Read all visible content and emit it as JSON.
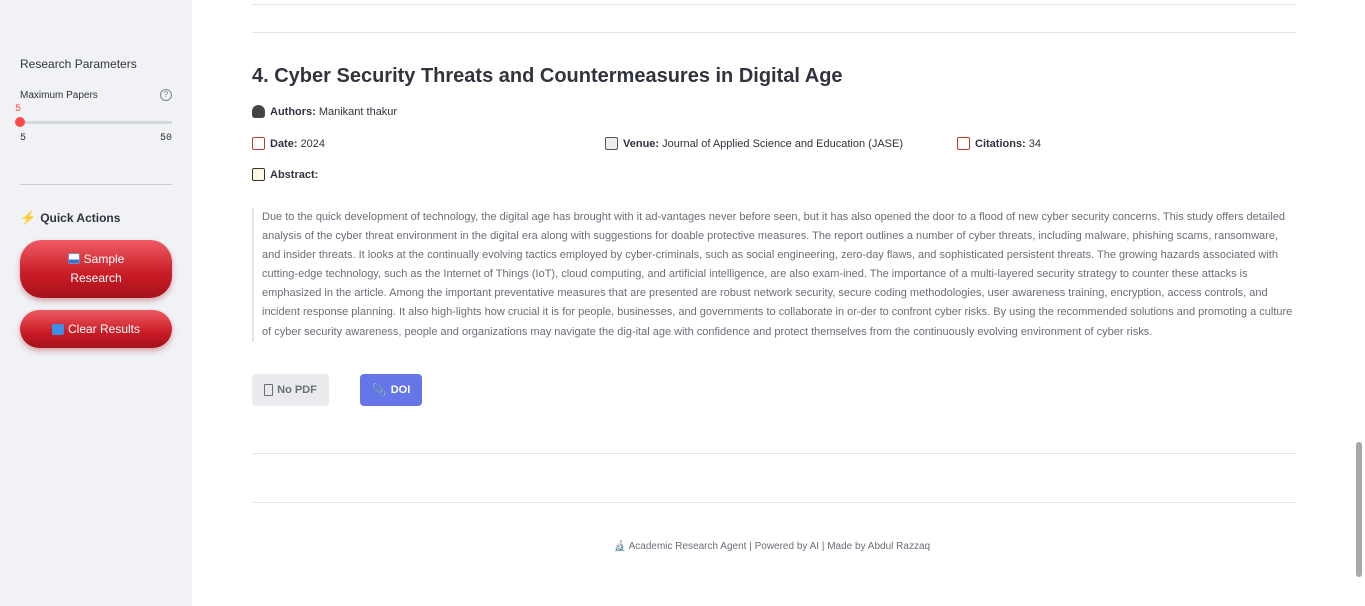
{
  "sidebar": {
    "section_title": "Research Parameters",
    "slider": {
      "label": "Maximum Papers",
      "help": "?",
      "value": "5",
      "min": "5",
      "max": "50"
    },
    "quick_actions": {
      "header": "Quick Actions",
      "sample_button": "Sample Research",
      "clear_button": "Clear Results"
    }
  },
  "paper": {
    "title": "4. Cyber Security Threats and Countermeasures in Digital Age",
    "authors_label": "Authors:",
    "authors": "Manikant thakur",
    "date_label": "Date:",
    "date": "2024",
    "venue_label": "Venue:",
    "venue": "Journal of Applied Science and Education (JASE)",
    "citations_label": "Citations:",
    "citations": "34",
    "abstract_label": "Abstract:",
    "abstract": "Due to the quick development of technology, the digital age has brought with it ad-vantages never before seen, but it has also opened the door to a flood of new cyber security concerns. This study offers detailed analysis of the cyber threat environment in the digital era along with suggestions for doable protective measures. The report outlines a number of cyber threats, including malware, phishing scams, ransomware, and insider threats. It looks at the continually evolving tactics employed by cyber-criminals, such as social engineering, zero-day flaws, and sophisticated persistent threats. The growing hazards associated with cutting-edge technology, such as the Internet of Things (IoT), cloud computing, and artificial intelligence, are also exam-ined. The importance of a multi-layered security strategy to counter these attacks is emphasized in the article. Among the important preventative measures that are presented are robust network security, secure coding methodologies, user awareness training, encryption, access controls, and incident response planning. It also high-lights how crucial it is for people, businesses, and governments to collaborate in or-der to confront cyber risks. By using the recommended solutions and promoting a culture of cyber security awareness, people and organizations may navigate the dig-ital age with confidence and protect themselves from the continuously evolving environment of cyber risks.",
    "nopdf_label": "No PDF",
    "doi_label": "DOI"
  },
  "footer": {
    "text": "Academic Research Agent | Powered by AI | Made by Abdul Razzaq"
  },
  "colors": {
    "accent_red": "#ff4b4b",
    "button_red": "#c81b25",
    "doi_blue": "#6675e8",
    "sidebar_bg": "#f0f2f6"
  },
  "icons": {
    "authors": "people-icon",
    "date": "calendar-icon",
    "venue": "newspaper-icon",
    "citations": "chart-up-icon",
    "abstract": "memo-icon",
    "quick_actions": "lightning-icon",
    "nopdf": "document-icon",
    "doi": "paperclip-icon",
    "footer": "microscope-icon"
  }
}
